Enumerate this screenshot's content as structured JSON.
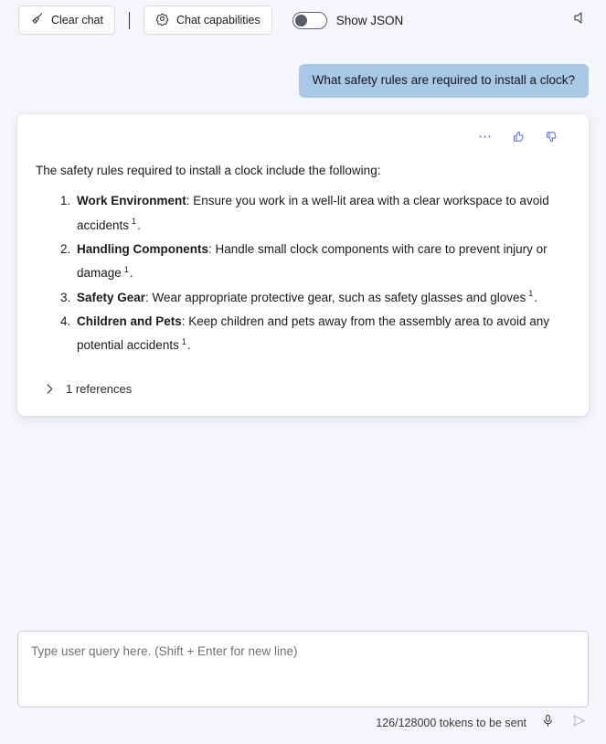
{
  "toolbar": {
    "clear_chat_label": "Clear chat",
    "clear_chat_icon": "broom-icon",
    "chat_capabilities_label": "Chat capabilities",
    "chat_capabilities_icon": "gear-icon",
    "show_json_label": "Show JSON",
    "show_json_state": "off",
    "speaker_icon": "speaker-mute-icon"
  },
  "conversation": {
    "user_message": "What safety rules are required to install a clock?",
    "assistant": {
      "actions": {
        "more_icon": "ellipsis-icon",
        "like_icon": "thumbs-up-icon",
        "dislike_icon": "thumbs-down-icon"
      },
      "intro": "The safety rules required to install a clock include the following:",
      "items": [
        {
          "number": "1.",
          "title": "Work Environment",
          "text": ": Ensure you work in a well-lit area with a clear workspace to avoid accidents",
          "citation": "1",
          "suffix": "."
        },
        {
          "number": "2.",
          "title": "Handling Components",
          "text": ": Handle small clock components with care to prevent injury or damage",
          "citation": "1",
          "suffix": "."
        },
        {
          "number": "3.",
          "title": "Safety Gear",
          "text": ": Wear appropriate protective gear, such as safety glasses and gloves",
          "citation": "1",
          "suffix": "."
        },
        {
          "number": "4.",
          "title": "Children and Pets",
          "text": ": Keep children and pets away from the assembly area to avoid any potential accidents",
          "citation": "1",
          "suffix": "."
        }
      ],
      "references_label": "1 references",
      "references_icon": "chevron-right-icon"
    }
  },
  "composer": {
    "placeholder": "Type user query here. (Shift + Enter for new line)",
    "value": "",
    "token_status": "126/128000 tokens to be sent",
    "mic_icon": "microphone-icon",
    "send_icon": "send-icon"
  },
  "colors": {
    "background": "#f4f6fb",
    "user_bubble": "#a8c8e8",
    "accent": "#4f6bd8",
    "card": "#ffffff"
  }
}
